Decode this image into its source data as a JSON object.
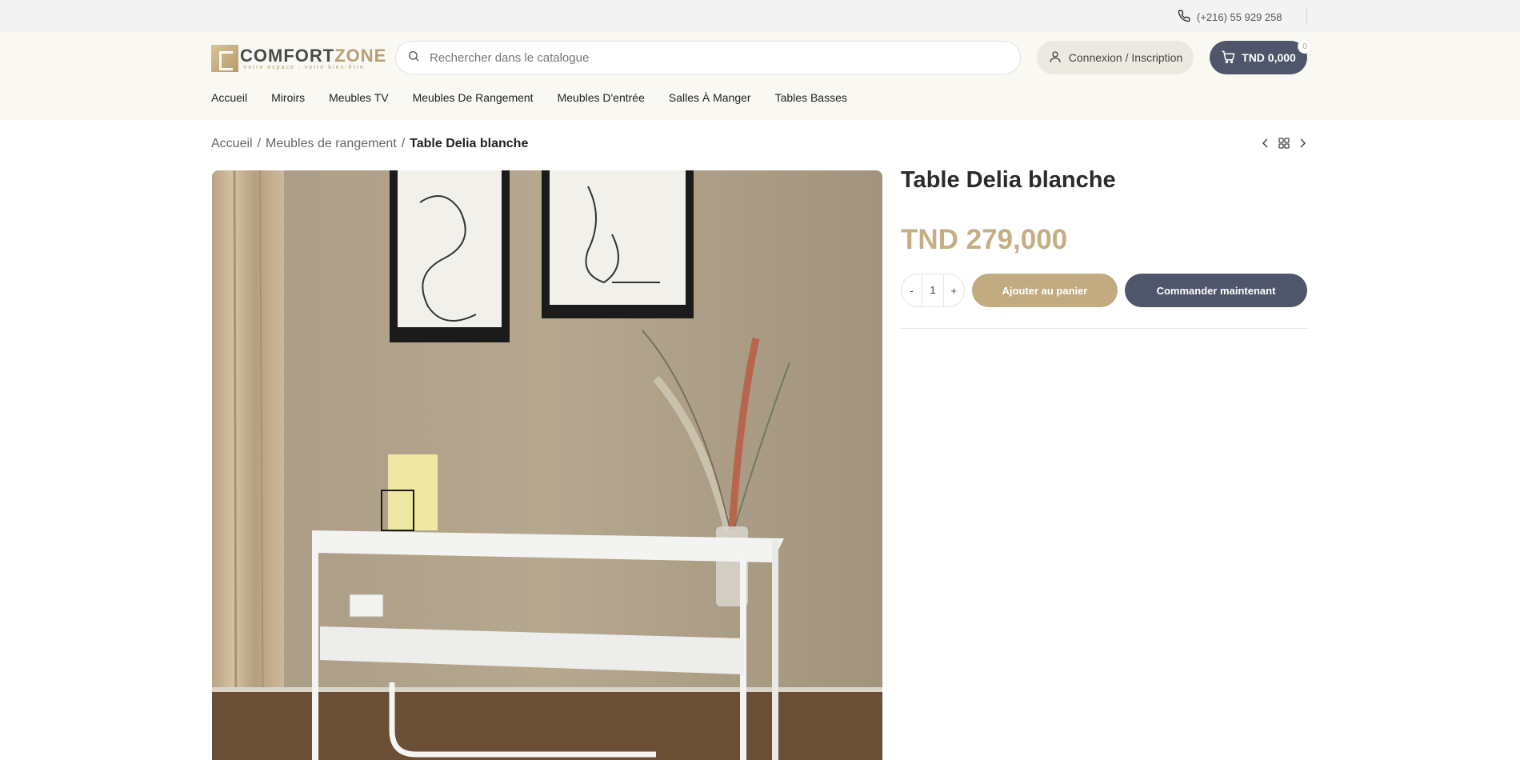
{
  "topbar": {
    "phone": "(+216) 55 929 258"
  },
  "header": {
    "logo": {
      "brand_main": "COMFORT",
      "brand_accent": "ZONE",
      "tagline": "Votre espace , votre bien-être"
    },
    "search": {
      "placeholder": "Rechercher dans le catalogue"
    },
    "login_label": "Connexion / Inscription",
    "cart": {
      "total": "TND 0,000",
      "count": "0"
    }
  },
  "nav": {
    "items": [
      {
        "label": "Accueil"
      },
      {
        "label": "Miroirs"
      },
      {
        "label": "Meubles TV"
      },
      {
        "label": "Meubles De Rangement"
      },
      {
        "label": "Meubles D'entrée"
      },
      {
        "label": "Salles À Manger"
      },
      {
        "label": "Tables Basses"
      }
    ]
  },
  "breadcrumb": {
    "items": [
      {
        "label": "Accueil"
      },
      {
        "label": "Meubles de rangement"
      }
    ],
    "current": "Table Delia blanche",
    "separator": "/"
  },
  "product": {
    "title": "Table Delia blanche",
    "price": "TND 279,000",
    "quantity": {
      "minus": "-",
      "value": "1",
      "plus": "+"
    },
    "add_to_cart": "Ajouter au panier",
    "order_now": "Commander maintenant"
  },
  "colors": {
    "accent_gold": "#c2aa81",
    "dark_button": "#4f556a",
    "header_bg": "#f9f8f3",
    "topbar_bg": "#f3f3f3"
  },
  "icons": [
    "phone-icon",
    "search-icon",
    "user-icon",
    "cart-icon",
    "chevron-left-icon",
    "grid-icon",
    "chevron-right-icon"
  ]
}
